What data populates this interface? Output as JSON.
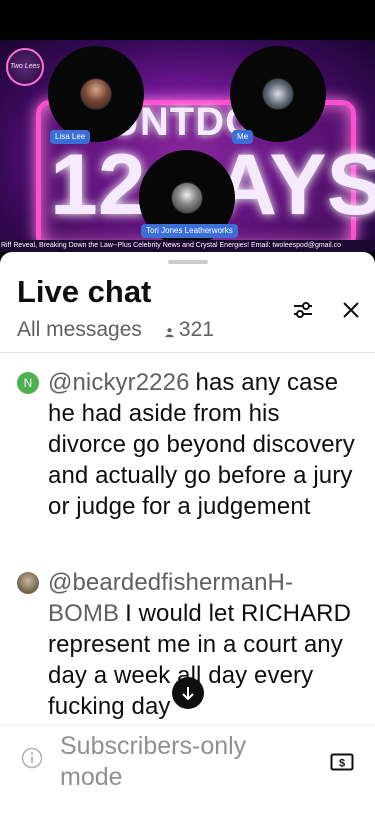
{
  "video": {
    "logo_text": "Two Lees",
    "countdown_word": "UNTDOW",
    "big_number": "12",
    "big_word": "AYS",
    "participants": [
      {
        "name": "Lisa Lee"
      },
      {
        "name": "Me"
      },
      {
        "name": "Tori Jones Leatherworks"
      }
    ],
    "ticker": "Riff Reveal, Breaking Down the Law--Plus Celebrity News and Crystal Energies! Email: twoleespod@gmail.co"
  },
  "chat": {
    "title": "Live chat",
    "filter": "All messages",
    "viewer_count": "321",
    "messages": [
      {
        "author": "@nickyr2226",
        "avatar_letter": "N",
        "avatar_color": "#4caf50",
        "text": "has any case he had aside from his divorce go beyond discovery and actually go before a jury or judge for a judgement"
      },
      {
        "author": "@beardedfishermanH-BOMB",
        "avatar_color": "#8a7a66",
        "text": "I would let RICHARD represent me in a court any day a week all day every fucking day"
      }
    ],
    "input_placeholder": "Subscribers-only mode"
  }
}
